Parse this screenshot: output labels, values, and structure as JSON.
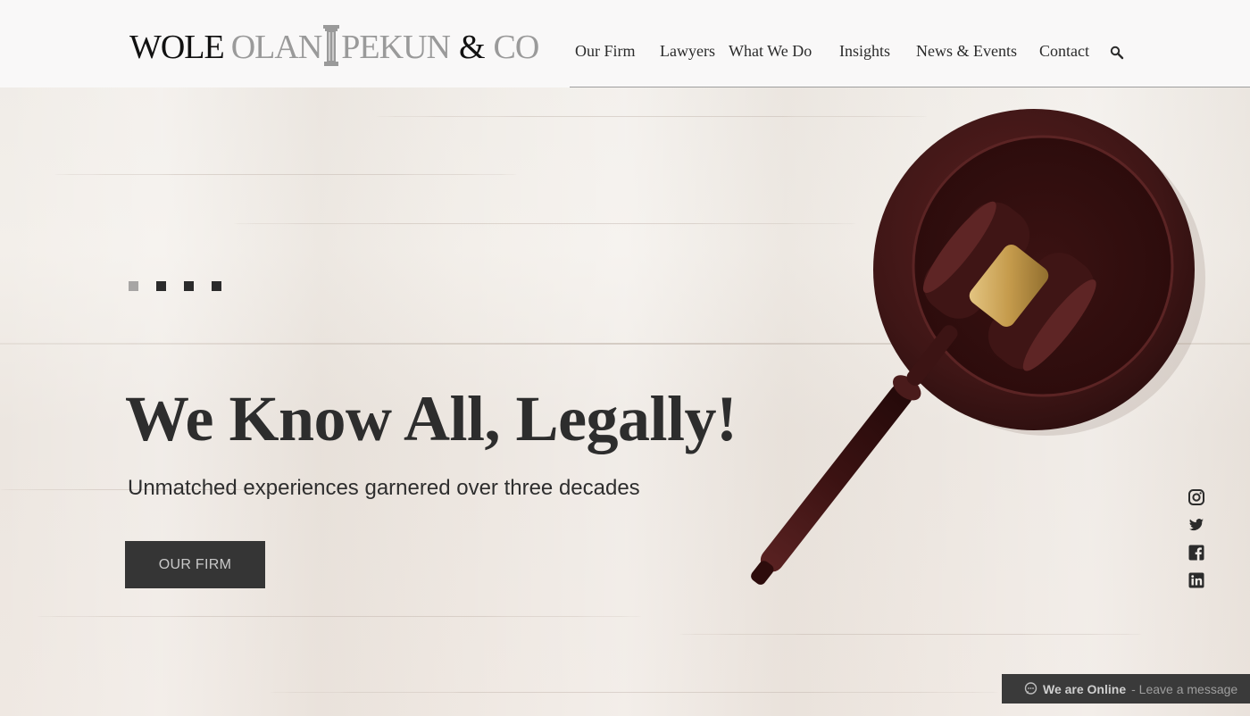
{
  "brand": {
    "logo_part1": "WOLE",
    "logo_part2": "OLAN",
    "logo_part3": "PEKUN",
    "logo_part4": "&",
    "logo_part5": "CO"
  },
  "nav": {
    "items": [
      {
        "label": "Our Firm"
      },
      {
        "label": "Lawyers"
      },
      {
        "label": "What We Do"
      },
      {
        "label": "Insights"
      },
      {
        "label": "News & Events"
      },
      {
        "label": "Contact"
      }
    ],
    "search_icon": "search-icon"
  },
  "slider": {
    "dot_count": 4,
    "active_index": 0
  },
  "hero": {
    "headline": "We Know All, Legally!",
    "subheadline": "Unmatched experiences garnered over three decades",
    "cta_label": "OUR FIRM"
  },
  "social": {
    "icons": [
      "instagram-icon",
      "twitter-icon",
      "facebook-icon",
      "linkedin-icon"
    ]
  },
  "chat": {
    "status": "We are Online",
    "action": "- Leave a message",
    "icon": "chat-bubble-icon"
  },
  "colors": {
    "header_bg": "#f9f8f8",
    "text_dark": "#2d2d2d",
    "button_bg": "#353535",
    "gavel_brown": "#4a1c1c",
    "gavel_gold": "#c9a35a"
  }
}
